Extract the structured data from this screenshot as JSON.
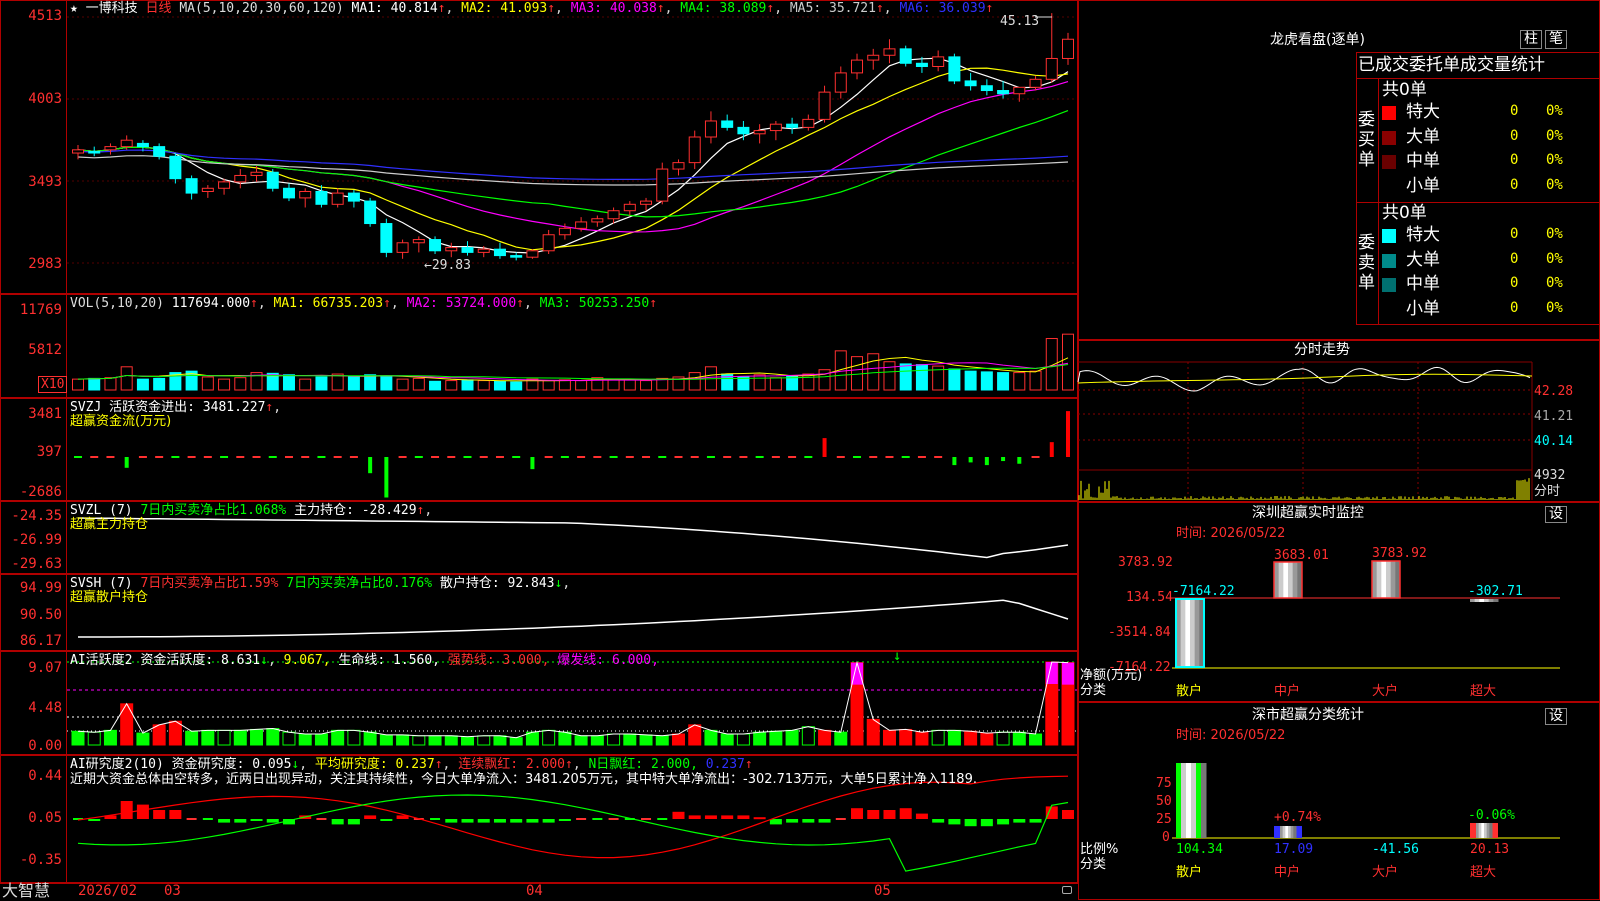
{
  "stock": {
    "star": "★",
    "name": "一博科技",
    "period": "日线",
    "ma_label": "MA(5,10,20,30,60,120)",
    "ma": [
      {
        "label": "MA1: 40.814",
        "color": "#ffffff"
      },
      {
        "label": "MA2: 41.093",
        "color": "#ffff00"
      },
      {
        "label": "MA3: 40.038",
        "color": "#ff00ff"
      },
      {
        "label": "MA4: 38.089",
        "color": "#00ff00"
      },
      {
        "label": "MA5: 35.721",
        "color": "#cccccc"
      },
      {
        "label": "MA6: 36.039",
        "color": "#3030ff"
      }
    ],
    "high_mark": "45.13",
    "low_mark": "←29.83",
    "y_ticks": [
      "4513",
      "4003",
      "3493",
      "2983"
    ]
  },
  "volume": {
    "title": "VOL(5,10,20)",
    "value": "117694.000",
    "ma": [
      {
        "label": "MA1: 66735.203",
        "color": "#ffff00"
      },
      {
        "label": "MA2: 53724.000",
        "color": "#ff00ff"
      },
      {
        "label": "MA3: 50253.250",
        "color": "#00ff00"
      }
    ],
    "y_ticks": [
      "11769",
      "5812"
    ],
    "unit": "X10"
  },
  "svzj": {
    "line1": "SVZJ  活跃资金进出: 3481.227",
    "line2": "超赢资金流(万元)",
    "y_ticks": [
      "3481",
      "397",
      "-2686"
    ]
  },
  "svzl": {
    "name": "SVZL (7)",
    "p1": "7日内买卖净占比1.068%",
    "p2": "主力持仓: -28.429",
    "line2": "超赢主力持仓",
    "y_ticks": [
      "-24.35",
      "-26.99",
      "-29.63"
    ]
  },
  "svsh": {
    "name": "SVSH (7)",
    "p1": "7日内买卖净占比1.59%",
    "p2": "7日内买卖净占比0.176%",
    "p3": "散户持仓: 92.843",
    "line2": "超赢散户持仓",
    "y_ticks": [
      "94.99",
      "90.50",
      "86.17"
    ]
  },
  "ai_active": {
    "name": "AI活跃度2",
    "p1": "资金活跃度: 8.631",
    "p2": "9.067,",
    "p3": "生命线: 1.560,",
    "p4": "强势线: 3.000,",
    "p5": "爆发线: 6.000,",
    "y_ticks": [
      "9.07",
      "4.48",
      "0.00"
    ]
  },
  "ai_research": {
    "name": "AI研究度2(10)",
    "p1": "资金研究度: 0.095",
    "p2": "平均研究度: 0.237",
    "p3": "连续飘红: 2.000",
    "p4": "N日飘红: 2.000,",
    "p5": "0.237",
    "comment": "近期大资金总体由空转多，近两日出现异动，关注其持续性，今日大单净流入：3481.205万元，其中特大单净流出：-302.713万元，大单5日累计净入1189.",
    "y_ticks": [
      "0.44",
      "0.05",
      "-0.35"
    ]
  },
  "bottom_axis": {
    "brand": "大智慧",
    "labels": [
      "2026/02",
      "03",
      "04",
      "05"
    ]
  },
  "longhu": {
    "title": "龙虎看盘(逐单)",
    "btn_col": "柱",
    "btn_pen": "笔",
    "header": "已成交委托单成交量统计",
    "buy_label": "委买单",
    "sell_label": "委卖单",
    "buy_total": "共0单",
    "sell_total": "共0单",
    "buy_rows": [
      {
        "label": "特大",
        "count": "0",
        "pct": "0%",
        "color": "#ff0000"
      },
      {
        "label": "大单",
        "count": "0",
        "pct": "0%",
        "color": "#8b0000"
      },
      {
        "label": "中单",
        "count": "0",
        "pct": "0%",
        "color": "#6a0000"
      },
      {
        "label": "小单",
        "count": "0",
        "pct": "0%",
        "color": "#000000"
      }
    ],
    "sell_rows": [
      {
        "label": "特大",
        "count": "0",
        "pct": "0%",
        "color": "#00ffff"
      },
      {
        "label": "大单",
        "count": "0",
        "pct": "0%",
        "color": "#008b8b"
      },
      {
        "label": "中单",
        "count": "0",
        "pct": "0%",
        "color": "#007070"
      },
      {
        "label": "小单",
        "count": "0",
        "pct": "0%",
        "color": "#000000"
      }
    ]
  },
  "intraday": {
    "title": "分时走势",
    "y_ticks": [
      "42.28",
      "41.21",
      "40.14"
    ],
    "vol_tick": "4932",
    "unit": "分时"
  },
  "sz_monitor": {
    "title": "深圳超赢实时监控",
    "set": "设",
    "time": "时间: 2026/05/22",
    "y_ticks": [
      "3783.92",
      "134.54",
      "-3514.84",
      "-7164.22"
    ],
    "unit": "净额(万元)",
    "cat_label": "分类",
    "cats": [
      "散户",
      "中户",
      "大户",
      "超大"
    ],
    "values": [
      "-7164.22",
      "3683.01",
      "3783.92",
      "-302.71"
    ]
  },
  "sz_class": {
    "title": "深市超赢分类统计",
    "set": "设",
    "time": "时间: 2026/05/22",
    "y_ticks": [
      "75",
      "50",
      "25",
      "0"
    ],
    "unit": "比例%",
    "cat_label": "分类",
    "cats": [
      "散户",
      "中户",
      "大户",
      "超大"
    ],
    "pcts": [
      "",
      "+0.74%",
      "",
      "-0.06%"
    ],
    "values": [
      "104.34",
      "17.09",
      "-41.56",
      "20.13"
    ]
  },
  "chart_data": {
    "type": "candlestick",
    "x_axis_labels": [
      "2026/02",
      "03",
      "04",
      "05"
    ],
    "price_axis_ticks": [
      45.13,
      40.03,
      34.93,
      29.83
    ],
    "ohlc_approx": [
      [
        36.4,
        36.9,
        36.0,
        36.6
      ],
      [
        36.5,
        36.8,
        36.2,
        36.4
      ],
      [
        36.6,
        37.0,
        36.3,
        36.8
      ],
      [
        36.8,
        37.5,
        36.6,
        37.2
      ],
      [
        37.0,
        37.2,
        36.5,
        36.8
      ],
      [
        36.8,
        37.0,
        36.0,
        36.2
      ],
      [
        36.2,
        36.4,
        34.5,
        34.8
      ],
      [
        34.8,
        35.0,
        33.5,
        33.9
      ],
      [
        34.0,
        34.4,
        33.6,
        34.2
      ],
      [
        34.2,
        34.8,
        33.8,
        34.6
      ],
      [
        34.6,
        35.4,
        34.2,
        35.0
      ],
      [
        35.0,
        35.6,
        34.6,
        35.2
      ],
      [
        35.2,
        35.4,
        34.0,
        34.2
      ],
      [
        34.2,
        34.5,
        33.4,
        33.6
      ],
      [
        33.6,
        34.2,
        33.0,
        34.0
      ],
      [
        34.0,
        34.4,
        33.0,
        33.2
      ],
      [
        33.2,
        34.2,
        33.0,
        33.9
      ],
      [
        33.9,
        34.1,
        33.0,
        33.4
      ],
      [
        33.4,
        33.6,
        31.8,
        32.0
      ],
      [
        32.0,
        32.3,
        29.9,
        30.2
      ],
      [
        30.2,
        31.0,
        29.8,
        30.8
      ],
      [
        30.8,
        31.2,
        30.2,
        31.0
      ],
      [
        31.0,
        31.2,
        30.1,
        30.3
      ],
      [
        30.3,
        30.8,
        29.9,
        30.5
      ],
      [
        30.5,
        30.9,
        30.0,
        30.2
      ],
      [
        30.2,
        30.6,
        29.9,
        30.4
      ],
      [
        30.4,
        30.8,
        29.8,
        30.0
      ],
      [
        30.0,
        30.2,
        29.7,
        29.9
      ],
      [
        29.9,
        30.4,
        29.8,
        30.3
      ],
      [
        30.3,
        31.6,
        30.1,
        31.3
      ],
      [
        31.3,
        32.0,
        31.0,
        31.7
      ],
      [
        31.7,
        32.4,
        31.5,
        32.1
      ],
      [
        32.1,
        32.5,
        31.8,
        32.3
      ],
      [
        32.3,
        33.0,
        32.0,
        32.8
      ],
      [
        32.8,
        33.4,
        32.5,
        33.2
      ],
      [
        33.2,
        33.6,
        32.8,
        33.4
      ],
      [
        33.4,
        35.8,
        33.2,
        35.4
      ],
      [
        35.4,
        36.0,
        35.0,
        35.8
      ],
      [
        35.8,
        37.8,
        35.4,
        37.4
      ],
      [
        37.4,
        39.0,
        37.0,
        38.4
      ],
      [
        38.4,
        38.8,
        37.8,
        38.0
      ],
      [
        38.0,
        38.4,
        37.2,
        37.6
      ],
      [
        37.6,
        38.2,
        37.0,
        37.8
      ],
      [
        37.8,
        38.4,
        37.2,
        38.2
      ],
      [
        38.2,
        38.6,
        37.6,
        38.0
      ],
      [
        38.0,
        38.8,
        37.8,
        38.5
      ],
      [
        38.5,
        40.6,
        38.3,
        40.2
      ],
      [
        40.2,
        41.8,
        39.8,
        41.4
      ],
      [
        41.4,
        42.6,
        41.0,
        42.2
      ],
      [
        42.2,
        42.9,
        41.6,
        42.5
      ],
      [
        42.5,
        43.5,
        42.0,
        42.9
      ],
      [
        42.9,
        43.1,
        41.8,
        42.0
      ],
      [
        42.0,
        42.4,
        41.4,
        41.8
      ],
      [
        41.8,
        42.8,
        41.5,
        42.4
      ],
      [
        42.4,
        42.6,
        40.7,
        40.9
      ],
      [
        40.9,
        41.4,
        40.3,
        40.6
      ],
      [
        40.6,
        41.0,
        40.0,
        40.3
      ],
      [
        40.3,
        40.9,
        39.8,
        40.1
      ],
      [
        40.1,
        40.5,
        39.6,
        40.5
      ],
      [
        40.5,
        41.2,
        40.3,
        41.0
      ],
      [
        41.0,
        45.13,
        40.8,
        42.3
      ],
      [
        42.3,
        43.9,
        41.9,
        43.5
      ]
    ],
    "volume_scaled_x10": [
      1500,
      1600,
      1700,
      3200,
      1500,
      1600,
      2400,
      2600,
      1800,
      1500,
      1700,
      2400,
      2300,
      2100,
      1500,
      1800,
      2200,
      1900,
      2100,
      1800,
      1500,
      1600,
      1200,
      1300,
      1400,
      1300,
      1200,
      1100,
      1500,
      1300,
      1400,
      1300,
      1700,
      1500,
      1400,
      1300,
      1600,
      1800,
      2400,
      3200,
      2200,
      1800,
      2100,
      1700,
      2000,
      2200,
      2800,
      5400,
      4600,
      5000,
      3900,
      3600,
      3500,
      3300,
      2900,
      2600,
      2500,
      2400,
      2400,
      2600,
      7100,
      7700
    ],
    "volume_axis_ticks": [
      11769,
      5812
    ]
  }
}
